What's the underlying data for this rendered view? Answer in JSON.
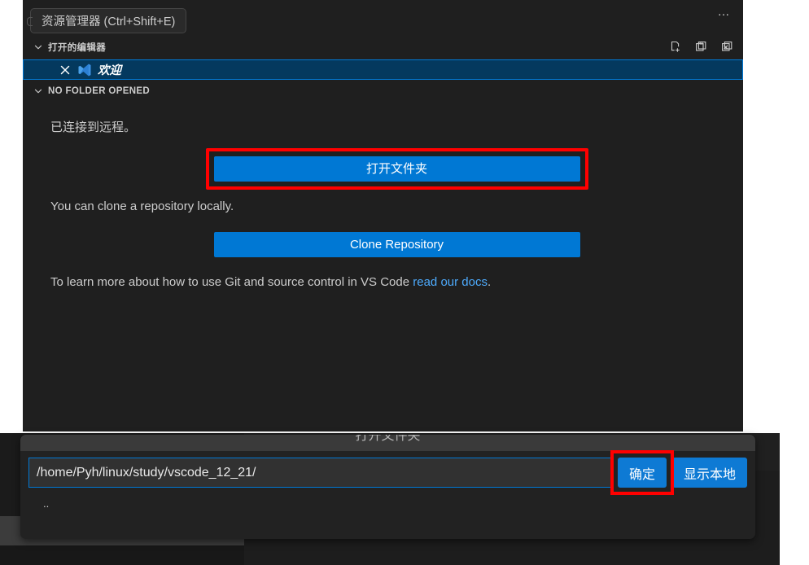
{
  "explorer": {
    "tooltip": "资源管理器 (Ctrl+Shift+E)",
    "overflow_menu": "…",
    "sections": {
      "open_editors": {
        "label": "打开的编辑器",
        "actions": [
          {
            "name": "new-untitled-file-icon",
            "title": "新建无标题文件"
          },
          {
            "name": "save-all-icon",
            "title": "全部保存"
          },
          {
            "name": "close-all-editors-icon",
            "title": "关闭所有编辑器"
          }
        ],
        "items": [
          {
            "label": "欢迎",
            "icon": "vscode-logo-icon",
            "close": "×"
          }
        ]
      },
      "no_folder": {
        "label": "NO FOLDER OPENED",
        "connected_text": "已连接到远程。",
        "open_folder_button": "打开文件夹",
        "clone_text": "You can clone a repository locally.",
        "clone_button": "Clone Repository",
        "docs_text_before": "To learn more about how to use Git and source control in VS Code ",
        "docs_link": "read our docs",
        "docs_text_after": "."
      }
    }
  },
  "dialog": {
    "title": "打开文件夹",
    "path_value": "/home/Pyh/linux/study/vscode_12_21/",
    "path_placeholder": "",
    "ok_button": "确定",
    "show_local_button": "显示本地",
    "list": [
      {
        "label": ".."
      }
    ]
  },
  "colors": {
    "accent_blue": "#0078d4",
    "button_blue": "#0e7ad4",
    "link_blue": "#4daafc",
    "highlight_red": "#ff0000",
    "panel_bg": "#1f1f1f",
    "selected_row_bg": "#04395e"
  }
}
